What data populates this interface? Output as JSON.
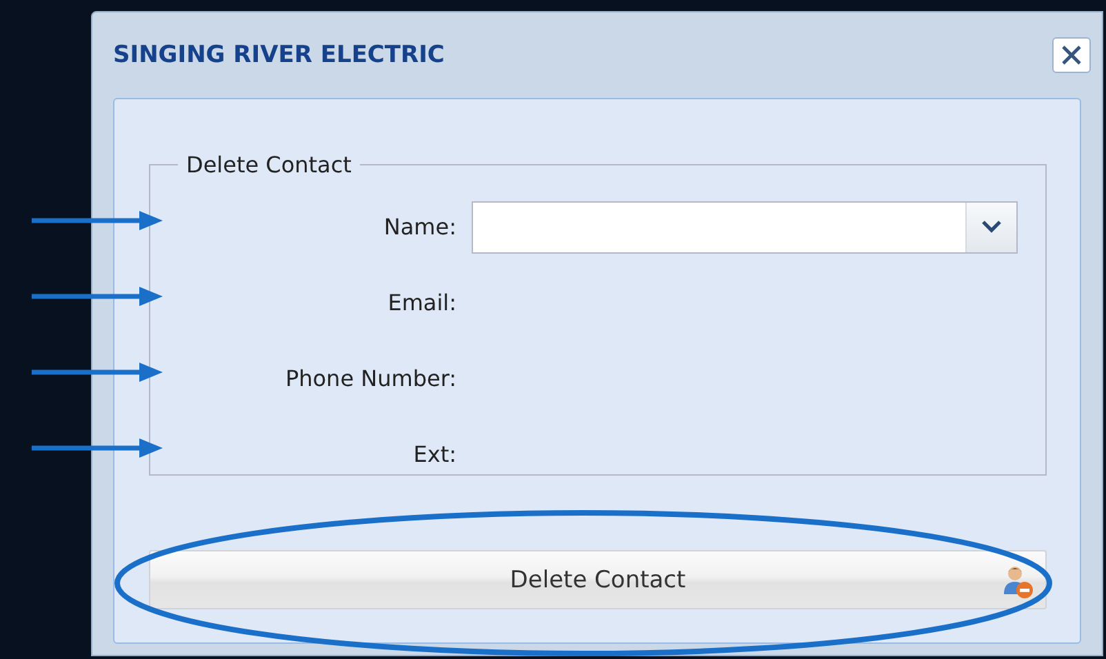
{
  "window": {
    "title": "SINGING RIVER ELECTRIC"
  },
  "form": {
    "legend": "Delete Contact",
    "fields": [
      {
        "label": "Name:",
        "kind": "combo",
        "arrow": true
      },
      {
        "label": "Email:",
        "kind": "text",
        "arrow": true
      },
      {
        "label": "Phone Number:",
        "kind": "text",
        "arrow": true
      },
      {
        "label": "Ext:",
        "kind": "text",
        "arrow": true
      }
    ]
  },
  "button": {
    "label": "Delete Contact",
    "circled": true
  }
}
